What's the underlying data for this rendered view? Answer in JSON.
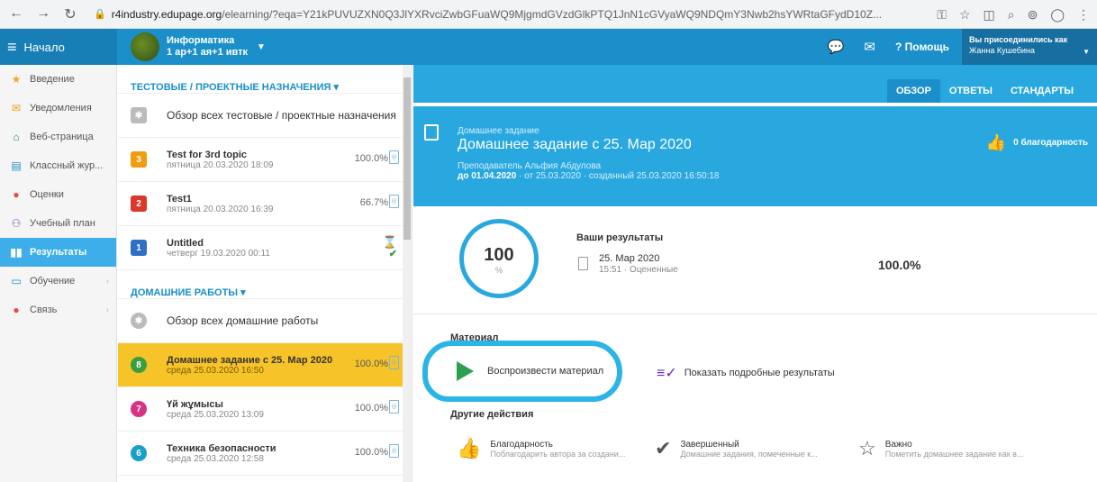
{
  "browser": {
    "url_host": "r4industry.edupage.org",
    "url_path": "/elearning/?eqa=Y21kPUVUZXN0Q3JlYXRvciZwbGFuaWQ9MjgmdGVzdGlkPTQ1JnN1cGVyaWQ9NDQmY3Nwb2hsYWRtaGFydD10Z..."
  },
  "topbar": {
    "home_label": "Начало",
    "course_name": "Информатика",
    "course_group": "1 ар+1 ая+1 ивтк",
    "help_label": "Помощь",
    "login_label": "Вы присоединились как",
    "user_name": "Жанна Кушебина"
  },
  "sidebar": {
    "items": [
      {
        "label": "Введение",
        "icon": "star-icon"
      },
      {
        "label": "Уведомления",
        "icon": "envelope-icon"
      },
      {
        "label": "Веб-страница",
        "icon": "house-icon"
      },
      {
        "label": "Классный жур...",
        "icon": "journal-icon"
      },
      {
        "label": "Оценки",
        "icon": "grades-icon"
      },
      {
        "label": "Учебный план",
        "icon": "plan-icon"
      },
      {
        "label": "Результаты",
        "icon": "results-icon"
      },
      {
        "label": "Обучение",
        "icon": "learning-icon"
      },
      {
        "label": "Связь",
        "icon": "chat-icon"
      }
    ]
  },
  "list": {
    "section1_title": "ТЕСТОВЫЕ / ПРОЕКТНЫЕ НАЗНАЧЕНИЯ",
    "section1_overview": "Обзор всех тестовые / проектные назначения",
    "tests": [
      {
        "num": "3",
        "title": "Test for 3rd topic",
        "date": "пятница 20.03.2020 18:09",
        "pct": "100.0%",
        "color": "#f39c12"
      },
      {
        "num": "2",
        "title": "Test1",
        "date": "пятница 20.03.2020 16:39",
        "pct": "66.7%",
        "color": "#d9382a"
      },
      {
        "num": "1",
        "title": "Untitled",
        "date": "четверг 19.03.2020 00:11",
        "pct": "",
        "color": "#2f6fc4"
      }
    ],
    "section2_title": "ДОМАШНИЕ РАБОТЫ",
    "section2_overview": "Обзор всех домашние работы",
    "homeworks": [
      {
        "num": "8",
        "title": "Домашнее задание с 25. Мар 2020",
        "date": "среда 25.03.2020 16:50",
        "pct": "100.0%",
        "color": "#3a9d3f"
      },
      {
        "num": "7",
        "title": "Үй жұмысы",
        "date": "среда 25.03.2020 13:09",
        "pct": "100.0%",
        "color": "#d63384"
      },
      {
        "num": "6",
        "title": "Техника безопасности",
        "date": "среда 25.03.2020 12:58",
        "pct": "100.0%",
        "color": "#1a9fc9"
      }
    ]
  },
  "main": {
    "tabs": [
      "ОБЗОР",
      "ОТВЕТЫ",
      "СТАНДАРТЫ"
    ],
    "type_label": "Домашнее задание",
    "title": "Домашнее задание с 25. Мар 2020",
    "teacher": "Преподаватель Альфия Абдулова",
    "due": "до 01.04.2020",
    "dates_rest": " · от 25.03.2020 · созданный 25.03.2020 16:50:18",
    "thanks": "0 благодарность",
    "score": "100",
    "score_unit": "%",
    "results_title": "Ваши результаты",
    "result_date": "25. Мар 2020",
    "result_time": "15:51 · Оцененные",
    "result_pct": "100.0%",
    "material_title": "Материал",
    "play_label": "Воспроизвести материал",
    "show_results": "Показать подробные результаты",
    "other_title": "Другие действия",
    "actions": [
      {
        "title": "Благодарность",
        "desc": "Поблагодарить автора за создани..."
      },
      {
        "title": "Завершенный",
        "desc": "Домашние задания, помеченные к..."
      },
      {
        "title": "Важно",
        "desc": "Пометить домашнее задание как в..."
      }
    ]
  }
}
